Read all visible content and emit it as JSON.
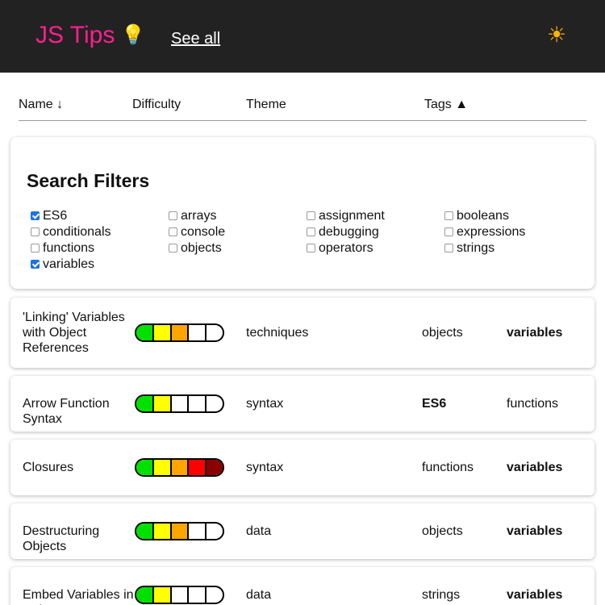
{
  "header": {
    "title": "JS Tips",
    "bulb_glyph": "💡",
    "see_all_label": "See all",
    "theme_icon": "sun-icon",
    "theme_glyph": "☀",
    "title_color": "#ff1f8e"
  },
  "columns": {
    "name": "Name ↓",
    "difficulty": "Difficulty",
    "theme": "Theme",
    "tags": "Tags ▲"
  },
  "filters": {
    "heading": "Search Filters",
    "options": [
      {
        "label": "ES6",
        "checked": true
      },
      {
        "label": "arrays",
        "checked": false
      },
      {
        "label": "assignment",
        "checked": false
      },
      {
        "label": "booleans",
        "checked": false
      },
      {
        "label": "conditionals",
        "checked": false
      },
      {
        "label": "console",
        "checked": false
      },
      {
        "label": "debugging",
        "checked": false
      },
      {
        "label": "expressions",
        "checked": false
      },
      {
        "label": "functions",
        "checked": false
      },
      {
        "label": "objects",
        "checked": false
      },
      {
        "label": "operators",
        "checked": false
      },
      {
        "label": "strings",
        "checked": false
      },
      {
        "label": "variables",
        "checked": true
      }
    ]
  },
  "difficulty_colors": [
    "#00e000",
    "#ffff00",
    "#ffa500",
    "#ff0000",
    "#8b0000"
  ],
  "tips": [
    {
      "name": "'Linking' Variables with Object References",
      "difficulty": 3,
      "theme": "techniques",
      "tags": [
        "objects",
        "variables"
      ],
      "bold_tag": 1
    },
    {
      "name": "Arrow Function Syntax",
      "difficulty": 2,
      "theme": "syntax",
      "tags": [
        "ES6",
        "functions"
      ],
      "bold_tag": 0
    },
    {
      "name": "Closures",
      "difficulty": 5,
      "theme": "syntax",
      "tags": [
        "functions",
        "variables"
      ],
      "bold_tag": 1
    },
    {
      "name": "Destructuring Objects",
      "difficulty": 3,
      "theme": "data",
      "tags": [
        "objects",
        "variables"
      ],
      "bold_tag": 1
    },
    {
      "name": "Embed Variables in Strings",
      "difficulty": 2,
      "theme": "data",
      "tags": [
        "strings",
        "variables"
      ],
      "bold_tag": 1
    }
  ]
}
